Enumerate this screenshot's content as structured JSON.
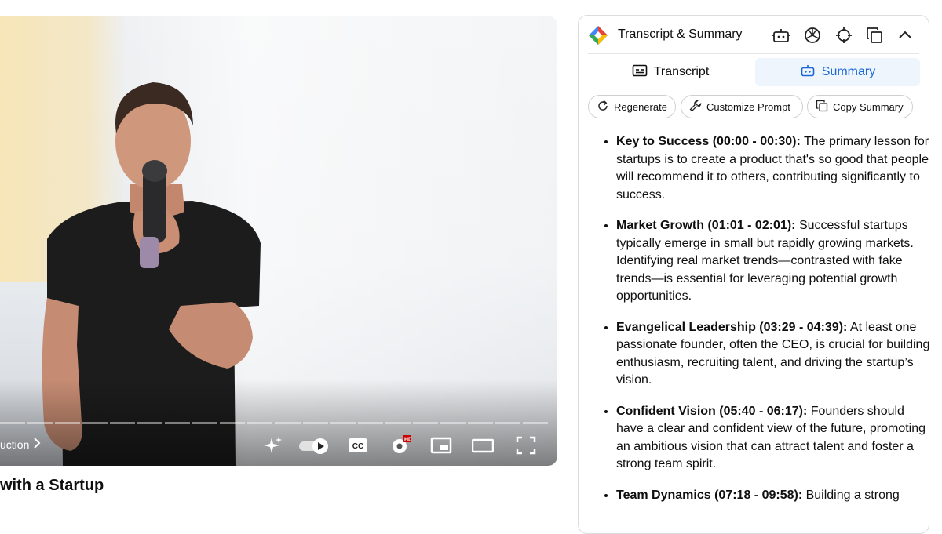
{
  "video": {
    "chapter_label": "uction",
    "title": "with a Startup"
  },
  "panel": {
    "title": "Transcript & Summary",
    "icons": [
      "robot-icon",
      "openai-icon",
      "crosshair-icon",
      "copy-icon",
      "chevron-up-icon"
    ],
    "tabs": [
      {
        "label": "Transcript",
        "icon": "subtitles-icon"
      },
      {
        "label": "Summary",
        "icon": "robot-icon",
        "active": true
      }
    ],
    "actions": [
      {
        "label": "Regenerate",
        "icon": "refresh-icon"
      },
      {
        "label": "Customize Prompt",
        "icon": "wrench-icon"
      },
      {
        "label": "Copy Summary",
        "icon": "copy-icon"
      }
    ],
    "summary": [
      {
        "heading": "Key to Success (00:00 - 00:30):",
        "text": " The primary lesson for startups is to create a product that's so good that people will recommend it to others, contributing significantly to success."
      },
      {
        "heading": "Market Growth (01:01 - 02:01):",
        "text": " Successful startups typically emerge in small but rapidly growing markets. Identifying real market trends—contrasted with fake trends—is essential for leveraging potential growth opportunities."
      },
      {
        "heading": "Evangelical Leadership (03:29 - 04:39):",
        "text": " At least one passionate founder, often the CEO, is crucial for building enthusiasm, recruiting talent, and driving the startup’s vision."
      },
      {
        "heading": "Confident Vision (05:40 - 06:17):",
        "text": " Founders should have a clear and confident view of the future, promoting an ambitious vision that can attract talent and foster a strong team spirit."
      },
      {
        "heading": "Team Dynamics (07:18 - 09:58):",
        "text": " Building a strong"
      }
    ]
  },
  "colors": {
    "accent_blue": "#1a66d6",
    "active_tab_bg": "#eef5fd",
    "hd_badge": "#cc0000"
  }
}
